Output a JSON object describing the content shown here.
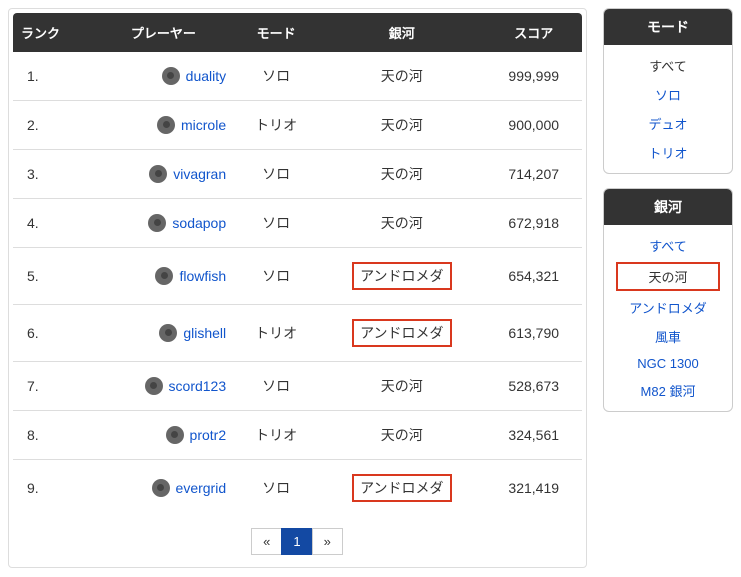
{
  "columns": {
    "rank": "ランク",
    "player": "プレーヤー",
    "mode": "モード",
    "galaxy": "銀河",
    "score": "スコア"
  },
  "rows": [
    {
      "rank": "1.",
      "player": "duality",
      "mode": "ソロ",
      "galaxy": "天の河",
      "galaxy_hot": false,
      "score": "999,999"
    },
    {
      "rank": "2.",
      "player": "microle",
      "mode": "トリオ",
      "galaxy": "天の河",
      "galaxy_hot": false,
      "score": "900,000"
    },
    {
      "rank": "3.",
      "player": "vivagran",
      "mode": "ソロ",
      "galaxy": "天の河",
      "galaxy_hot": false,
      "score": "714,207"
    },
    {
      "rank": "4.",
      "player": "sodapop",
      "mode": "ソロ",
      "galaxy": "天の河",
      "galaxy_hot": false,
      "score": "672,918"
    },
    {
      "rank": "5.",
      "player": "flowfish",
      "mode": "ソロ",
      "galaxy": "アンドロメダ",
      "galaxy_hot": true,
      "score": "654,321"
    },
    {
      "rank": "6.",
      "player": "glishell",
      "mode": "トリオ",
      "galaxy": "アンドロメダ",
      "galaxy_hot": true,
      "score": "613,790"
    },
    {
      "rank": "7.",
      "player": "scord123",
      "mode": "ソロ",
      "galaxy": "天の河",
      "galaxy_hot": false,
      "score": "528,673"
    },
    {
      "rank": "8.",
      "player": "protr2",
      "mode": "トリオ",
      "galaxy": "天の河",
      "galaxy_hot": false,
      "score": "324,561"
    },
    {
      "rank": "9.",
      "player": "evergrid",
      "mode": "ソロ",
      "galaxy": "アンドロメダ",
      "galaxy_hot": true,
      "score": "321,419"
    }
  ],
  "pager": {
    "prev": "«",
    "page": "1",
    "next": "»"
  },
  "filters": {
    "mode": {
      "title": "モード",
      "items": [
        {
          "label": "すべて",
          "link": false,
          "sel": false
        },
        {
          "label": "ソロ",
          "link": true,
          "sel": false
        },
        {
          "label": "デュオ",
          "link": true,
          "sel": false
        },
        {
          "label": "トリオ",
          "link": true,
          "sel": false
        }
      ]
    },
    "galaxy": {
      "title": "銀河",
      "items": [
        {
          "label": "すべて",
          "link": true,
          "sel": false
        },
        {
          "label": "天の河",
          "link": false,
          "sel": true
        },
        {
          "label": "アンドロメダ",
          "link": true,
          "sel": false
        },
        {
          "label": "風車",
          "link": true,
          "sel": false
        },
        {
          "label": "NGC 1300",
          "link": true,
          "sel": false
        },
        {
          "label": "M82 銀河",
          "link": true,
          "sel": false
        }
      ]
    }
  }
}
